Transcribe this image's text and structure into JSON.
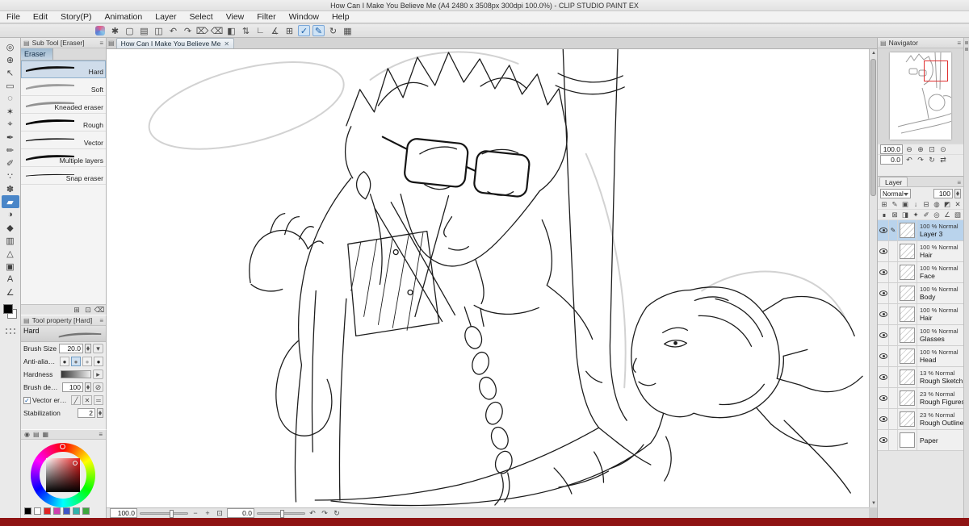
{
  "ui": {
    "menu_glyph": "≡",
    "bottom_bar_color": "#8f1414",
    "selection_blue": "#4a86c8"
  },
  "title_bar": {
    "title": "How Can I Make You Believe Me (A4 2480 x 3508px 300dpi 100.0%)  - CLIP STUDIO PAINT EX"
  },
  "menu": {
    "items": [
      "File",
      "Edit",
      "Story(P)",
      "Animation",
      "Layer",
      "Select",
      "View",
      "Filter",
      "Window",
      "Help"
    ]
  },
  "toolbar": {
    "icons": [
      {
        "name": "settings-icon",
        "glyph": "✱"
      },
      {
        "name": "new-file-icon",
        "glyph": "▢"
      },
      {
        "name": "open-file-icon",
        "glyph": "▤"
      },
      {
        "name": "save-icon",
        "glyph": "◫"
      },
      {
        "name": "undo-icon",
        "glyph": "↶"
      },
      {
        "name": "redo-icon",
        "glyph": "↷"
      },
      {
        "name": "delete-icon",
        "glyph": "⌦"
      },
      {
        "name": "delete-outside-selection-icon",
        "glyph": "⌫"
      },
      {
        "name": "fill-icon",
        "glyph": "◧"
      },
      {
        "name": "scale-rotate-icon",
        "glyph": "⇅"
      },
      {
        "name": "snap-to-ruler-icon",
        "glyph": "∟"
      },
      {
        "name": "snap-to-special-ruler-icon",
        "glyph": "∡"
      },
      {
        "name": "snap-to-grid-icon",
        "glyph": "⊞"
      },
      {
        "name": "correct-line-icon",
        "glyph": "✓",
        "active": true
      },
      {
        "name": "vector-snap-icon",
        "glyph": "✎",
        "active": true
      },
      {
        "name": "rotate-view-icon",
        "glyph": "↻"
      },
      {
        "name": "grid-view-icon",
        "glyph": "▦"
      }
    ]
  },
  "tool_strip": {
    "tools": [
      {
        "name": "zoom-tool",
        "glyph": "◎"
      },
      {
        "name": "move-tool",
        "glyph": "⊕"
      },
      {
        "name": "operation-tool",
        "glyph": "↖"
      },
      {
        "name": "marquee-select-tool",
        "glyph": "▭"
      },
      {
        "name": "lasso-tool",
        "glyph": "◌"
      },
      {
        "name": "auto-select-tool",
        "glyph": "✶"
      },
      {
        "name": "eyedropper-tool",
        "glyph": "⌖"
      },
      {
        "name": "pen-tool",
        "glyph": "✒"
      },
      {
        "name": "pencil-tool",
        "glyph": "✏"
      },
      {
        "name": "brush-tool",
        "glyph": "✐"
      },
      {
        "name": "airbrush-tool",
        "glyph": "∵"
      },
      {
        "name": "decoration-tool",
        "glyph": "✽"
      },
      {
        "name": "eraser-tool",
        "glyph": "▰",
        "selected": true
      },
      {
        "name": "blend-tool",
        "glyph": "◑"
      },
      {
        "name": "fill-tool",
        "glyph": "◆"
      },
      {
        "name": "gradient-tool",
        "glyph": "▥"
      },
      {
        "name": "figure-tool",
        "glyph": "△"
      },
      {
        "name": "frame-border-tool",
        "glyph": "▣"
      },
      {
        "name": "text-tool",
        "glyph": "A"
      },
      {
        "name": "ruler-tool",
        "glyph": "∠"
      }
    ]
  },
  "sub_tool_panel": {
    "header": "Sub Tool [Eraser]",
    "group_tab": "Eraser",
    "items": [
      {
        "label": "Hard",
        "selected": true
      },
      {
        "label": "Soft"
      },
      {
        "label": "Kneaded eraser"
      },
      {
        "label": "Rough"
      },
      {
        "label": "Vector"
      },
      {
        "label": "Multiple layers"
      },
      {
        "label": "Snap eraser"
      }
    ],
    "footer_icons": [
      {
        "name": "add-subtool-icon",
        "glyph": "⊞"
      },
      {
        "name": "duplicate-subtool-icon",
        "glyph": "⊡"
      },
      {
        "name": "delete-subtool-icon",
        "glyph": "⌫"
      }
    ]
  },
  "tool_property": {
    "header": "Tool property [Hard]",
    "preset": "Hard",
    "brush_size_label": "Brush Size",
    "brush_size_value": "20.0",
    "anti_alias_label": "Anti-aliasing",
    "anti_alias_options": [
      {
        "name": "anti-alias-none-icon",
        "glyph": "●"
      },
      {
        "name": "anti-alias-weak-icon",
        "glyph": "●",
        "selected": true
      },
      {
        "name": "anti-alias-middle-icon",
        "glyph": "●"
      },
      {
        "name": "anti-alias-strong-icon",
        "glyph": "●"
      }
    ],
    "hardness_label": "Hardness",
    "density_label": "Brush density",
    "density_value": "100",
    "vector_eraser_label": "Vector eraser",
    "vector_eraser_checked": "✓",
    "vector_modes": [
      {
        "name": "erase-touched-areas-icon",
        "glyph": "╱"
      },
      {
        "name": "erase-to-intersection-icon",
        "glyph": "✕"
      },
      {
        "name": "erase-whole-line-icon",
        "glyph": "═"
      }
    ],
    "stabilization_label": "Stabilization",
    "stabilization_value": "2"
  },
  "color_panel": {
    "tabs": [
      {
        "name": "color-wheel-tab-icon",
        "glyph": "◉"
      },
      {
        "name": "color-slider-tab-icon",
        "glyph": "▤"
      },
      {
        "name": "color-set-tab-icon",
        "glyph": "▦"
      }
    ],
    "selected_color": "#e81c1c",
    "swatches": [
      {
        "name": "main-color-swatch",
        "color": "#000000"
      },
      {
        "name": "sub-color-swatch",
        "color": "#ffffff"
      },
      {
        "name": "history-swatch-red",
        "color": "#e02424"
      },
      {
        "name": "history-swatch-magenta",
        "color": "#cf3fae"
      },
      {
        "name": "history-swatch-blue",
        "color": "#3f55c9"
      },
      {
        "name": "history-swatch-teal",
        "color": "#2fb3ab"
      },
      {
        "name": "history-swatch-green",
        "color": "#3da83d"
      }
    ]
  },
  "canvas": {
    "tab_label": "How Can I Make You Believe Me",
    "tab_close": "✕",
    "zoom_value": "100.0",
    "rotation_value": "0.0",
    "zoom_icons": [
      {
        "name": "zoom-out-icon",
        "glyph": "−"
      },
      {
        "name": "zoom-in-icon",
        "glyph": "+"
      },
      {
        "name": "fit-to-screen-icon",
        "glyph": "⊡"
      }
    ],
    "rotate_icons": [
      {
        "name": "rotate-left-icon",
        "glyph": "↶"
      },
      {
        "name": "rotate-right-icon",
        "glyph": "↷"
      },
      {
        "name": "reset-rotation-icon",
        "glyph": "↻"
      }
    ]
  },
  "navigator": {
    "header": "Navigator",
    "zoom_value": "100.0",
    "rotation_value": "0.0",
    "zoom_icons": [
      {
        "name": "zoom-out-icon",
        "glyph": "⊖"
      },
      {
        "name": "zoom-in-icon",
        "glyph": "⊕"
      },
      {
        "name": "fit-to-screen-icon",
        "glyph": "⊡"
      },
      {
        "name": "zoom-100-icon",
        "glyph": "⊙"
      }
    ],
    "rotate_icons": [
      {
        "name": "rotate-left-icon",
        "glyph": "↶"
      },
      {
        "name": "rotate-right-icon",
        "glyph": "↷"
      },
      {
        "name": "reset-rotation-icon",
        "glyph": "↻"
      },
      {
        "name": "flip-horizontal-icon",
        "glyph": "⇄"
      }
    ]
  },
  "layer_panel": {
    "tab": "Layer",
    "blend_value": "Normal",
    "opacity_value": "100",
    "toolbar_row1": [
      {
        "name": "new-raster-layer-icon",
        "glyph": "⊞"
      },
      {
        "name": "new-vector-layer-icon",
        "glyph": "✎"
      },
      {
        "name": "new-folder-icon",
        "glyph": "▣"
      },
      {
        "name": "transfer-layer-icon",
        "glyph": "↓"
      },
      {
        "name": "merge-down-icon",
        "glyph": "⊟"
      },
      {
        "name": "create-mask-icon",
        "glyph": "◍"
      },
      {
        "name": "apply-mask-icon",
        "glyph": "◩"
      },
      {
        "name": "delete-layer-icon",
        "glyph": "✕"
      }
    ],
    "toolbar_row2": [
      {
        "name": "lock-layer-icon",
        "glyph": "∎"
      },
      {
        "name": "lock-transparent-pixels-icon",
        "glyph": "⊠"
      },
      {
        "name": "clip-to-layer-below-icon",
        "glyph": "◨"
      },
      {
        "name": "reference-layer-icon",
        "glyph": "✦"
      },
      {
        "name": "draft-layer-icon",
        "glyph": "✐"
      },
      {
        "name": "enable-mask-icon",
        "glyph": "◎"
      },
      {
        "name": "ruler-icon",
        "glyph": "∠"
      },
      {
        "name": "layer-color-icon",
        "glyph": "▧"
      }
    ],
    "layers": [
      {
        "info": "100 % Normal",
        "name": "Layer 3",
        "selected": true,
        "edit": "✎"
      },
      {
        "info": "100 % Normal",
        "name": "Hair"
      },
      {
        "info": "100 % Normal",
        "name": "Face"
      },
      {
        "info": "100 % Normal",
        "name": "Body"
      },
      {
        "info": "100 % Normal",
        "name": "Hair"
      },
      {
        "info": "100 % Normal",
        "name": "Glasses"
      },
      {
        "info": "100 % Normal",
        "name": "Head"
      },
      {
        "info": "13 % Normal",
        "name": "Rough Sketch"
      },
      {
        "info": "23 % Normal",
        "name": "Rough Figures"
      },
      {
        "info": "23 % Normal",
        "name": "Rough Outlines"
      },
      {
        "info": "",
        "name": "Paper",
        "cls": "paper"
      }
    ]
  }
}
